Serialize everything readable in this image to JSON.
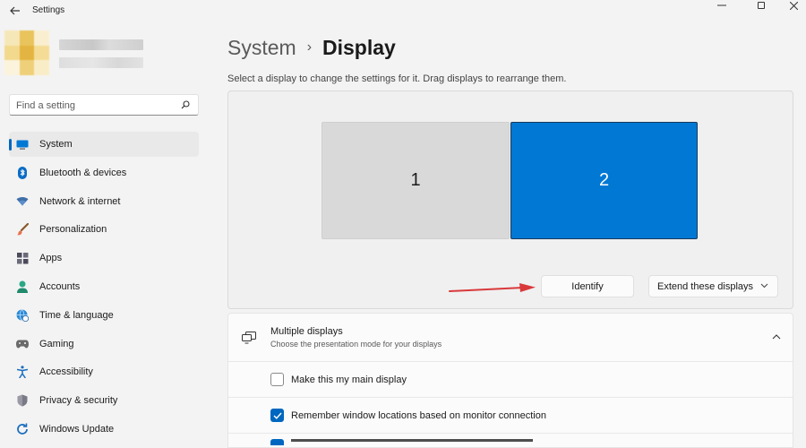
{
  "window": {
    "title": "Settings",
    "back_icon": "back-arrow-icon",
    "controls": [
      "minimize-icon",
      "maximize-icon",
      "close-icon"
    ]
  },
  "profile": {
    "avatar_colors": [
      "#f2d78a",
      "#e8c25a",
      "#f5e3a8"
    ]
  },
  "search": {
    "placeholder": "Find a setting",
    "icon": "search-icon"
  },
  "sidebar": {
    "items": [
      {
        "label": "System",
        "icon": "monitor-icon",
        "active": true
      },
      {
        "label": "Bluetooth & devices",
        "icon": "bluetooth-icon"
      },
      {
        "label": "Network & internet",
        "icon": "wifi-icon"
      },
      {
        "label": "Personalization",
        "icon": "brush-icon"
      },
      {
        "label": "Apps",
        "icon": "apps-icon"
      },
      {
        "label": "Accounts",
        "icon": "person-icon"
      },
      {
        "label": "Time & language",
        "icon": "globe-clock-icon"
      },
      {
        "label": "Gaming",
        "icon": "gamepad-icon"
      },
      {
        "label": "Accessibility",
        "icon": "accessibility-icon"
      },
      {
        "label": "Privacy & security",
        "icon": "shield-icon"
      },
      {
        "label": "Windows Update",
        "icon": "update-icon"
      }
    ]
  },
  "main": {
    "breadcrumb": {
      "parent": "System",
      "separator": "›",
      "current": "Display"
    },
    "instructions": "Select a display to change the settings for it. Drag displays to rearrange them.",
    "displays": [
      {
        "label": "1",
        "selected": false
      },
      {
        "label": "2",
        "selected": true
      }
    ],
    "identify_label": "Identify",
    "mode_select": {
      "value": "Extend these displays"
    },
    "multiple_displays": {
      "title": "Multiple displays",
      "subtitle": "Choose the presentation mode for your displays",
      "options": [
        {
          "label": "Make this my main display",
          "checked": false
        },
        {
          "label": "Remember window locations based on monitor connection",
          "checked": true
        }
      ]
    }
  },
  "colors": {
    "accent": "#0067c0",
    "selected_display": "#0078d4",
    "annotation_arrow": "#d9393b"
  }
}
